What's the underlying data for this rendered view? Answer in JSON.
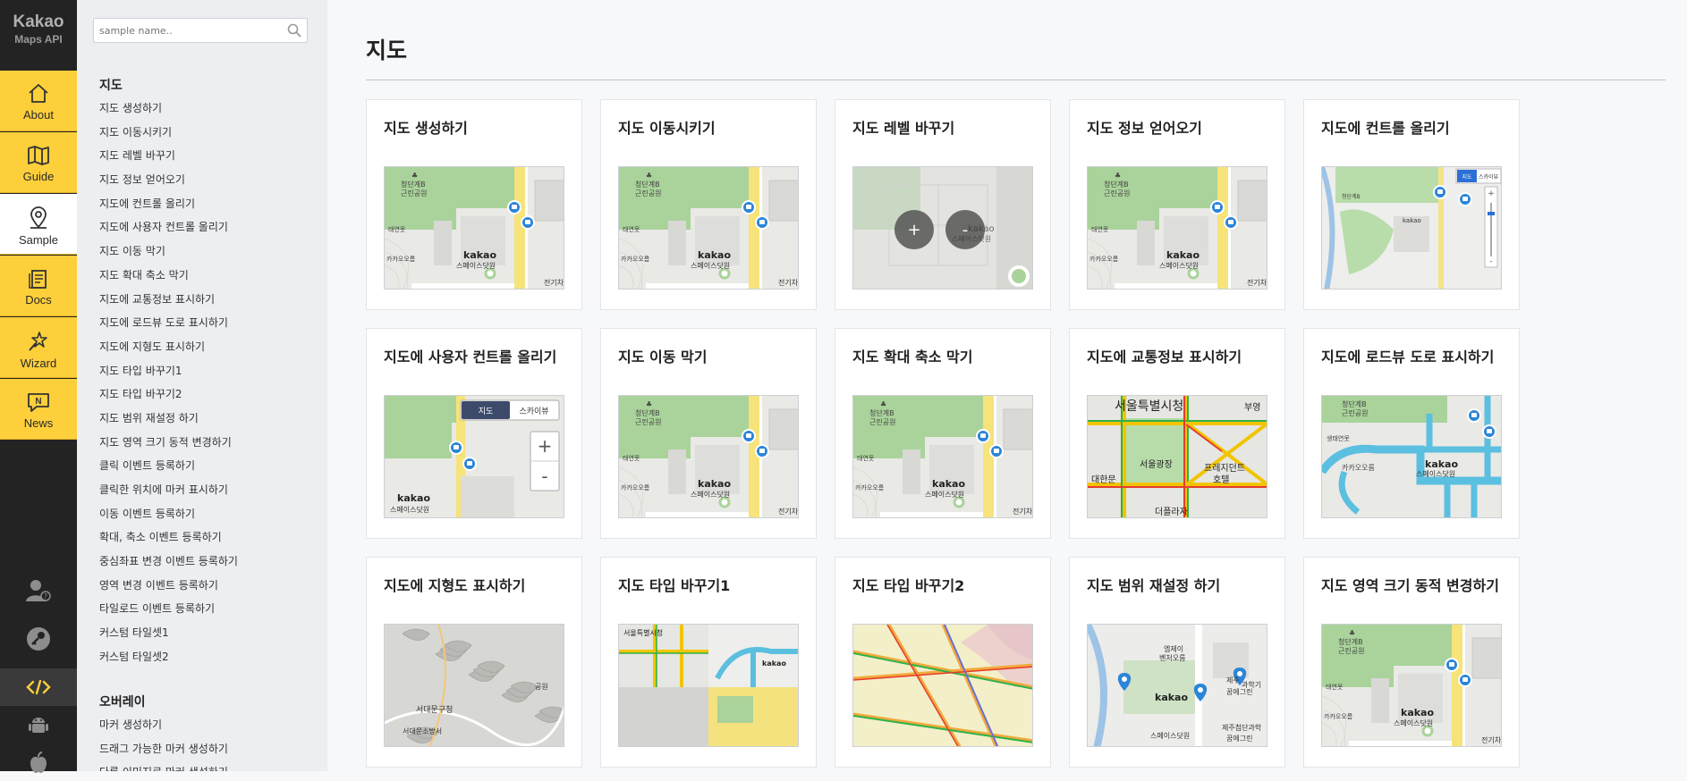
{
  "brand": {
    "line1": "Kakao",
    "line2": "Maps API"
  },
  "nav": [
    {
      "label": "About",
      "icon": "home-icon"
    },
    {
      "label": "Guide",
      "icon": "book-icon"
    },
    {
      "label": "Sample",
      "icon": "map-pin-icon"
    },
    {
      "label": "Docs",
      "icon": "docs-icon"
    },
    {
      "label": "Wizard",
      "icon": "wand-icon"
    },
    {
      "label": "News",
      "icon": "news-icon"
    }
  ],
  "bottom_icons": [
    "user-icon",
    "key-icon",
    "code-icon",
    "android-icon",
    "apple-icon"
  ],
  "search": {
    "placeholder": "sample name.."
  },
  "sidebar": {
    "section1": {
      "title": "지도",
      "items": [
        "지도 생성하기",
        "지도 이동시키기",
        "지도 레벨 바꾸기",
        "지도 정보 얻어오기",
        "지도에 컨트롤 올리기",
        "지도에 사용자 컨트롤 올리기",
        "지도 이동 막기",
        "지도 확대 축소 막기",
        "지도에 교통정보 표시하기",
        "지도에 로드뷰 도로 표시하기",
        "지도에 지형도 표시하기",
        "지도 타입 바꾸기1",
        "지도 타입 바꾸기2",
        "지도 범위 재설정 하기",
        "지도 영역 크기 동적 변경하기",
        "클릭 이벤트 등록하기",
        "클릭한 위치에 마커 표시하기",
        "이동 이벤트 등록하기",
        "확대, 축소 이벤트 등록하기",
        "중심좌표 변경 이벤트 등록하기",
        "영역 변경 이벤트 등록하기",
        "타일로드 이벤트 등록하기",
        "커스텀 타일셋1",
        "커스텀 타일셋2"
      ]
    },
    "section2": {
      "title": "오버레이",
      "items": [
        "마커 생성하기",
        "드래그 가능한 마커 생성하기",
        "다른 이미지로 마커 생성하기"
      ]
    }
  },
  "main": {
    "title": "지도",
    "cards": [
      {
        "title": "지도 생성하기",
        "thumb": "base"
      },
      {
        "title": "지도 이동시키기",
        "thumb": "base"
      },
      {
        "title": "지도 레벨 바꾸기",
        "thumb": "zoom"
      },
      {
        "title": "지도 정보 얻어오기",
        "thumb": "base"
      },
      {
        "title": "지도에 컨트롤 올리기",
        "thumb": "controls"
      },
      {
        "title": "지도에 사용자 컨트롤 올리기",
        "thumb": "custom"
      },
      {
        "title": "지도 이동 막기",
        "thumb": "base"
      },
      {
        "title": "지도 확대 축소 막기",
        "thumb": "base"
      },
      {
        "title": "지도에 교통정보 표시하기",
        "thumb": "traffic"
      },
      {
        "title": "지도에 로드뷰 도로 표시하기",
        "thumb": "roadview"
      },
      {
        "title": "지도에 지형도 표시하기",
        "thumb": "terrain"
      },
      {
        "title": "지도 타입 바꾸기1",
        "thumb": "mixed"
      },
      {
        "title": "지도 타입 바꾸기2",
        "thumb": "overlay"
      },
      {
        "title": "지도 범위 재설정 하기",
        "thumb": "bounds"
      },
      {
        "title": "지도 영역 크기 동적 변경하기",
        "thumb": "base"
      }
    ]
  },
  "map_labels": {
    "park": "청단계B\n근린공원",
    "park_l1": "청단계B",
    "park_l2": "근린공원",
    "place_a": "태연못",
    "place_b": "카카오오름",
    "kakao": "kakao",
    "kakao_sub": "스페이스닷원",
    "edge": "전기차",
    "ctrl_map": "지도",
    "ctrl_sky": "스카이뷰",
    "plus": "+",
    "minus": "-",
    "traffic_city": "서울특별시청",
    "traffic_plaza": "서울광장",
    "traffic_hotel1": "프레지던트",
    "traffic_hotel2": "호텔",
    "traffic_bldg": "더플라자",
    "traffic_gate": "대한문",
    "traffic_side": "부영",
    "roadview_place": "생태연못",
    "terrain_a": "서대문구청",
    "terrain_b": "서대문소방서",
    "terrain_c": "공원",
    "mixed_city": "서울특별시청",
    "bounds_a": "엠제이",
    "bounds_b": "벤처오름",
    "bounds_c": "제주",
    "bounds_d": "과학기",
    "bounds_e": "꿈에그린",
    "bounds_f": "제주첨단과학",
    "bounds_g": "꿈에그린"
  },
  "colors": {
    "nav_yellow": "#fdcf3a",
    "nav_dark": "#232323",
    "sidebar_bg": "#eceef1",
    "main_bg": "#f7f8fa",
    "code_accent": "#fdcf3a",
    "map_park": "#8fc57e",
    "map_road_yellow": "#f6e37a",
    "marker_blue": "#2b85d8"
  }
}
